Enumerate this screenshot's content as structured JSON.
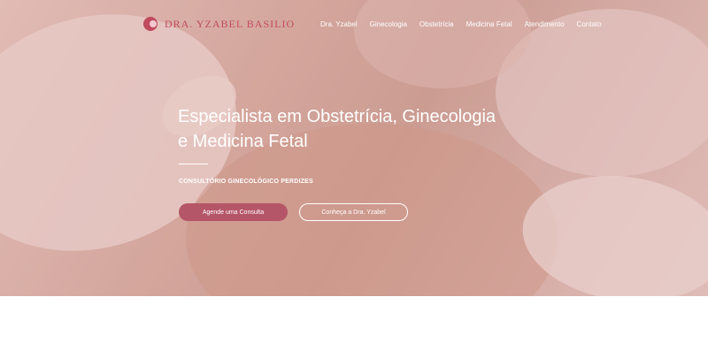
{
  "brand": {
    "name": "DRA. YZABEL BASILIO"
  },
  "nav": {
    "items": [
      {
        "label": "Dra. Yzabel"
      },
      {
        "label": "Ginecologia"
      },
      {
        "label": "Obstetrícia"
      },
      {
        "label": "Medicina Fetal"
      },
      {
        "label": "Atendimento"
      },
      {
        "label": "Contato"
      }
    ]
  },
  "hero": {
    "title_line1": "Especialista em Obstetrícia, Ginecologia",
    "title_line2": "e Medicina Fetal",
    "subtitle": "CONSULTÓRIO GINECOLÓGICO PERDIZES",
    "cta_primary": "Agende uma Consulta",
    "cta_secondary": "Conheça a Dra. Yzabel"
  },
  "colors": {
    "accent": "#b55568",
    "logo": "#c14c60"
  }
}
